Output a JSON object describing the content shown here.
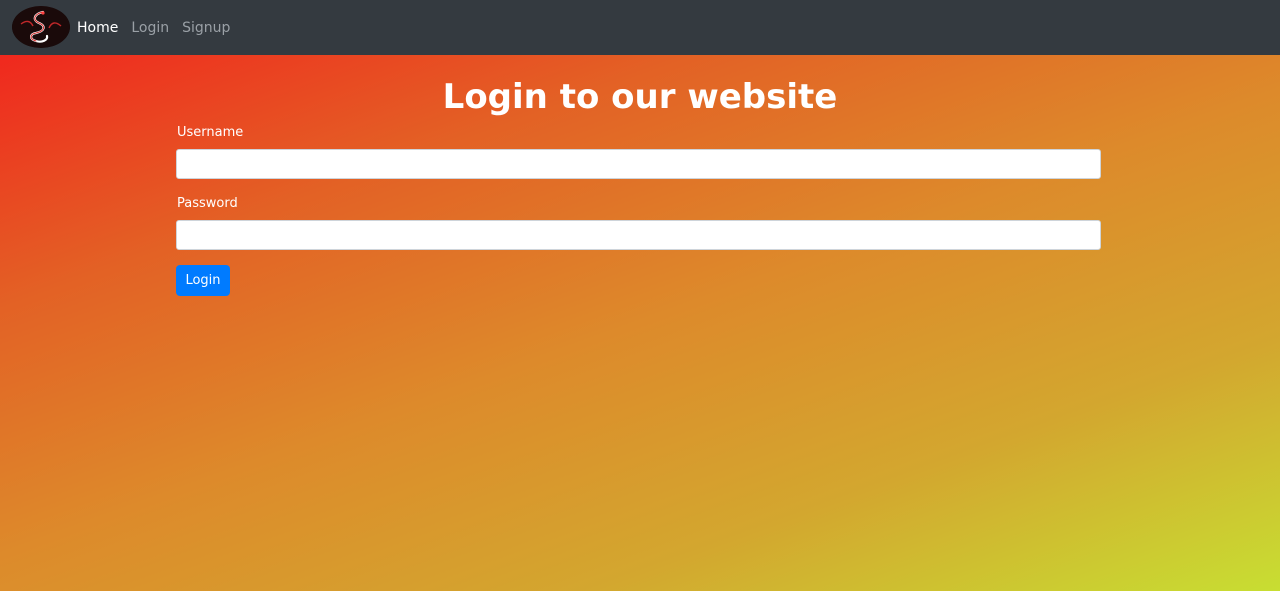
{
  "navbar": {
    "logo_icon": "dragon-logo-icon",
    "links": [
      {
        "label": "Home",
        "active": true
      },
      {
        "label": "Login",
        "active": false
      },
      {
        "label": "Signup",
        "active": false
      }
    ]
  },
  "page": {
    "heading": "Login to our website",
    "username_label": "Username",
    "username_value": "",
    "password_label": "Password",
    "password_value": "",
    "submit_label": "Login"
  },
  "colors": {
    "navbar_bg": "#343a40",
    "button_bg": "#007bff",
    "gradient_start": "#f0281e",
    "gradient_end": "#c8de32"
  }
}
